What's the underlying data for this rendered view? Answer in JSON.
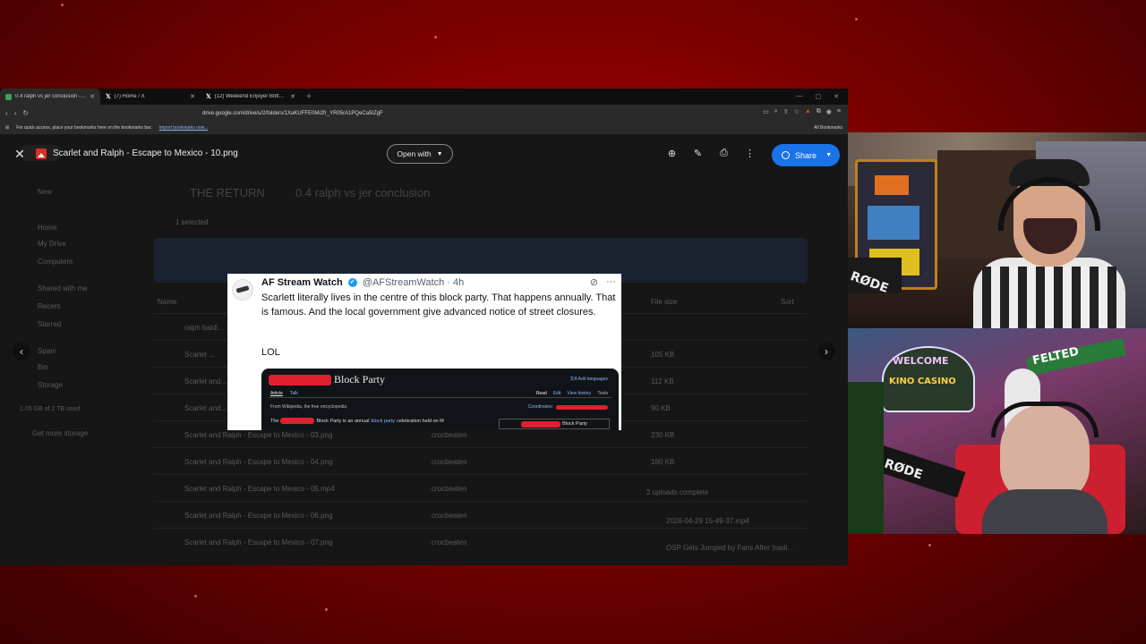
{
  "browser": {
    "tabs": [
      {
        "label": "0.4 ralph vs jer conclusion - Goo",
        "active": true,
        "icon": "google-drive-icon"
      },
      {
        "label": "(7) Home / X",
        "active": false,
        "icon": "x-logo-icon"
      },
      {
        "label": "(12) Weekend Enjoyer Brittany Venti",
        "active": false,
        "icon": "x-logo-icon"
      }
    ],
    "url": "drive.google.com/drive/u/2/folders/1XaKUFFE0Mi2fr_YR05rA1PQeCa5tZgF",
    "bookmarks_prompt": "For quick access, place your bookmarks here on the bookmarks bar.",
    "import_bookmarks": "Import bookmarks now...",
    "all_bookmarks": "All Bookmarks"
  },
  "viewer": {
    "file_title": "Scarlet and Ralph - Escape to Mexico - 10.png",
    "open_with": "Open with",
    "share": "Share"
  },
  "drive_background": {
    "new": "New",
    "breadcrumb_parent": "THE RETURN",
    "breadcrumb_current": "0.4 ralph vs jer conclusion",
    "sidebar": [
      "Home",
      "My Drive",
      "Computers",
      "Shared with me",
      "Recent",
      "Starred",
      "Spam",
      "Bin",
      "Storage"
    ],
    "storage_text": "1.05 GB of 2 TB used",
    "get_storage": "Get more storage",
    "selected": "1 selected",
    "column_name": "Name",
    "column_size": "File size",
    "column_sort": "Sort",
    "files": [
      {
        "name": "ralph baldl...",
        "size": ""
      },
      {
        "name": "Scarlet ...",
        "size": "105 KB"
      },
      {
        "name": "Scarlet and...",
        "size": "112 KB"
      },
      {
        "name": "Scarlet and...",
        "size": "90 KB"
      },
      {
        "name": "Scarlet and Ralph - Escape to Mexico - 03.png",
        "size": "230 KB"
      },
      {
        "name": "Scarlet and Ralph - Escape to Mexico - 04.png",
        "size": "180 KB"
      },
      {
        "name": "Scarlet and Ralph - Escape to Mexico - 05.mp4",
        "size": ""
      },
      {
        "name": "Scarlet and Ralph - Escape to Mexico - 06.png",
        "size": ""
      },
      {
        "name": "Scarlet and Ralph - Escape to Mexico - 07.png",
        "size": ""
      }
    ],
    "owner": "crocbeaten",
    "uploads_title": "2 uploads complete",
    "uploads": [
      "2026-04-29 15-49-37.mp4",
      "OSP Gets Jumped by Fans After Inadi..."
    ]
  },
  "tweet": {
    "name": "AF Stream Watch",
    "handle": "@AFStreamWatch",
    "time": "· 4h",
    "text": "Scarlett literally lives in the centre of this block party. That happens annually. That is famous. And the local government give advanced notice of street closures.",
    "lol": "LOL",
    "wiki": {
      "title_suffix": "Block Party",
      "add_languages": "Add languages",
      "tab_article": "Article",
      "tab_talk": "Talk",
      "tab_read": "Read",
      "tab_edit": "Edit",
      "tab_history": "View history",
      "tab_tools": "Tools",
      "from": "From Wikipedia, the free encyclopedia",
      "coordinates": "Coordinates:",
      "body_prefix": "The",
      "body_mid": "Block Party is an annual",
      "body_link": "block party",
      "body_suffix": "celebration held on M",
      "infobox_title": "Block Party"
    }
  },
  "stream": {
    "sign_welcome": "WELCOME",
    "sign_casino": "KINO CASINO",
    "sign_street": "FELTED",
    "mic_brand": "RØDE"
  },
  "colors": {
    "share": "#1a73e8",
    "redaction": "#e02030",
    "background_red": "#b00000"
  }
}
